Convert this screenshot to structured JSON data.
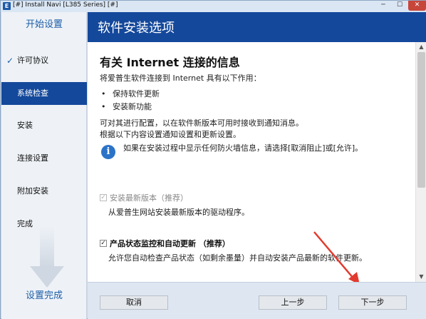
{
  "window": {
    "icon_letter": "E",
    "title": "[#] Install Navi [L385 Series] [#]",
    "minimize_glyph": "─",
    "maximize_glyph": "☐",
    "close_glyph": "✕"
  },
  "sidebar": {
    "header": "开始设置",
    "items": [
      {
        "label": "许可协议",
        "checked": true,
        "check_glyph": "✓"
      },
      {
        "label": "系统检查",
        "active": true
      },
      {
        "label": "安装"
      },
      {
        "label": "连接设置"
      },
      {
        "label": "附加安装"
      },
      {
        "label": "完成"
      }
    ],
    "footer": "设置完成"
  },
  "header": {
    "title": "软件安装选项"
  },
  "content": {
    "section_title": "有关 Internet 连接的信息",
    "intro": "将爱普生软件连接到 Internet 具有以下作用：",
    "bullets": [
      "保持软件更新",
      "安装新功能"
    ],
    "bullet_glyph": "•",
    "config_line1": "可对其进行配置，以在软件新版本可用时接收到通知消息。",
    "config_line2": "根据以下内容设置通知设置和更新设置。",
    "info_glyph": "i",
    "info_text": "如果在安装过程中显示任何防火墙信息，请选择[取消阻止]或[允许]。",
    "options": [
      {
        "label": "安装最新版本（推荐）",
        "description": "从爱普生网站安装最新版本的驱动程序。",
        "checked": true,
        "disabled": true
      },
      {
        "label": "产品状态监控和自动更新 （推荐）",
        "description": "允许您自动检查产品状态（如剩余墨量）并自动安装产品最新的软件更新。",
        "checked": true,
        "disabled": false
      }
    ],
    "checkbox_glyph": "✓"
  },
  "scrollbar": {
    "up_glyph": "▲",
    "down_glyph": "▼"
  },
  "footer": {
    "cancel_label": "取消",
    "back_label": "上一步",
    "next_label": "下一步"
  },
  "colors": {
    "accent": "#14489b",
    "sidebar_bg": "#eef2f7",
    "footer_bg": "#dde6f1",
    "annotation_arrow": "#e23a2e",
    "info_icon": "#2b73c8"
  }
}
